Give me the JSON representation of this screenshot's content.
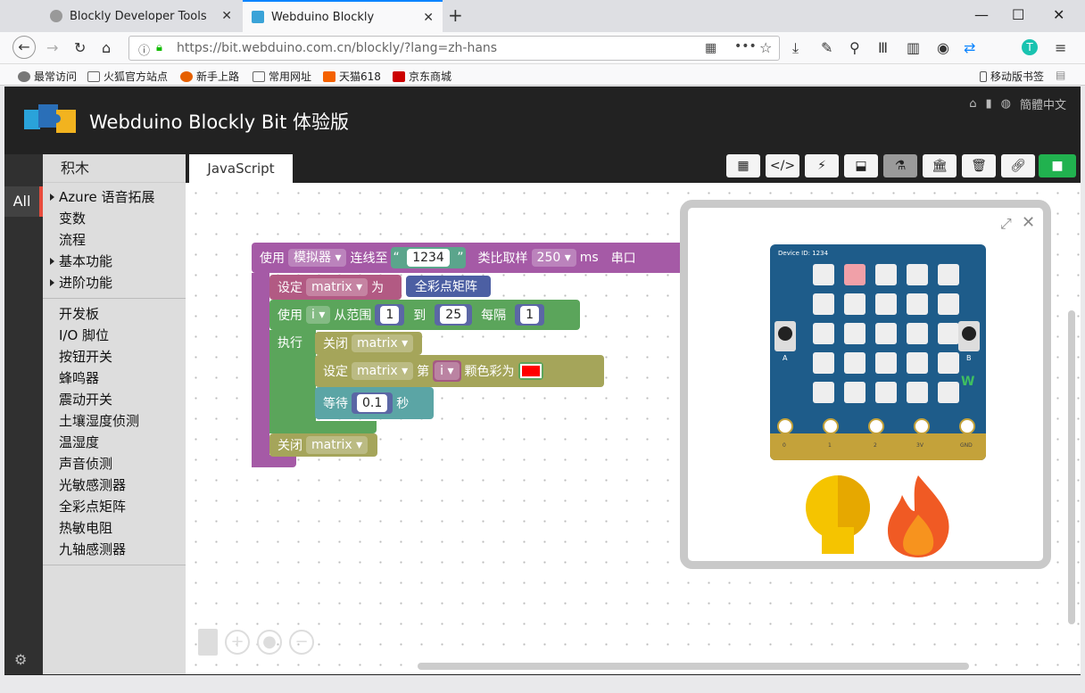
{
  "browser": {
    "tabs": [
      {
        "title": "Blockly Developer Tools"
      },
      {
        "title": "Webduino Blockly"
      }
    ],
    "url": "https://bit.webduino.com.cn/blockly/?lang=zh-hans",
    "bookmarks": [
      "最常访问",
      "火狐官方站点",
      "新手上路",
      "常用网址",
      "天猫618",
      "京东商城"
    ],
    "mobile_bookmarks": "移动版书签"
  },
  "app": {
    "title": "Webduino Blockly Bit 体验版",
    "lang": "簡體中文",
    "toolbox_title": "积木",
    "all_label": "All",
    "categories_top": [
      "Azure 语音拓展",
      "变数",
      "流程",
      "基本功能",
      "进阶功能"
    ],
    "categories_dev": [
      "开发板",
      "I/O 脚位",
      "按钮开关",
      "蜂鸣器",
      "震动开关",
      "土壤湿度侦测",
      "温湿度",
      "声音侦测",
      "光敏感测器",
      "全彩点矩阵",
      "热敏电阻",
      "九轴感测器"
    ],
    "code_tab": "JavaScript"
  },
  "blocks": {
    "use": "使用",
    "simulator": "模拟器",
    "connect": "连线至",
    "device_id": "1234",
    "sampling": "类比取样",
    "sample_val": "250",
    "ms": "ms",
    "serial": "串口",
    "set": "设定",
    "matrix": "matrix",
    "as": "为",
    "full_color_matrix": "全彩点矩阵",
    "use2": "使用",
    "var_i": "i",
    "from_range": "从范围",
    "from": "1",
    "to_label": "到",
    "to": "25",
    "step_label": "每隔",
    "step": "1",
    "do": "执行",
    "close": "关闭",
    "set2": "设定",
    "nth": "第",
    "color_as": "颗色彩为",
    "color": "#ff0000",
    "wait": "等待",
    "wait_val": "0.1",
    "sec": "秒",
    "close2": "关闭"
  },
  "sim": {
    "device_label": "Device ID: 1234",
    "btn_a": "A",
    "btn_b": "B",
    "pins": [
      "0",
      "1",
      "2",
      "3V",
      "GND"
    ]
  }
}
